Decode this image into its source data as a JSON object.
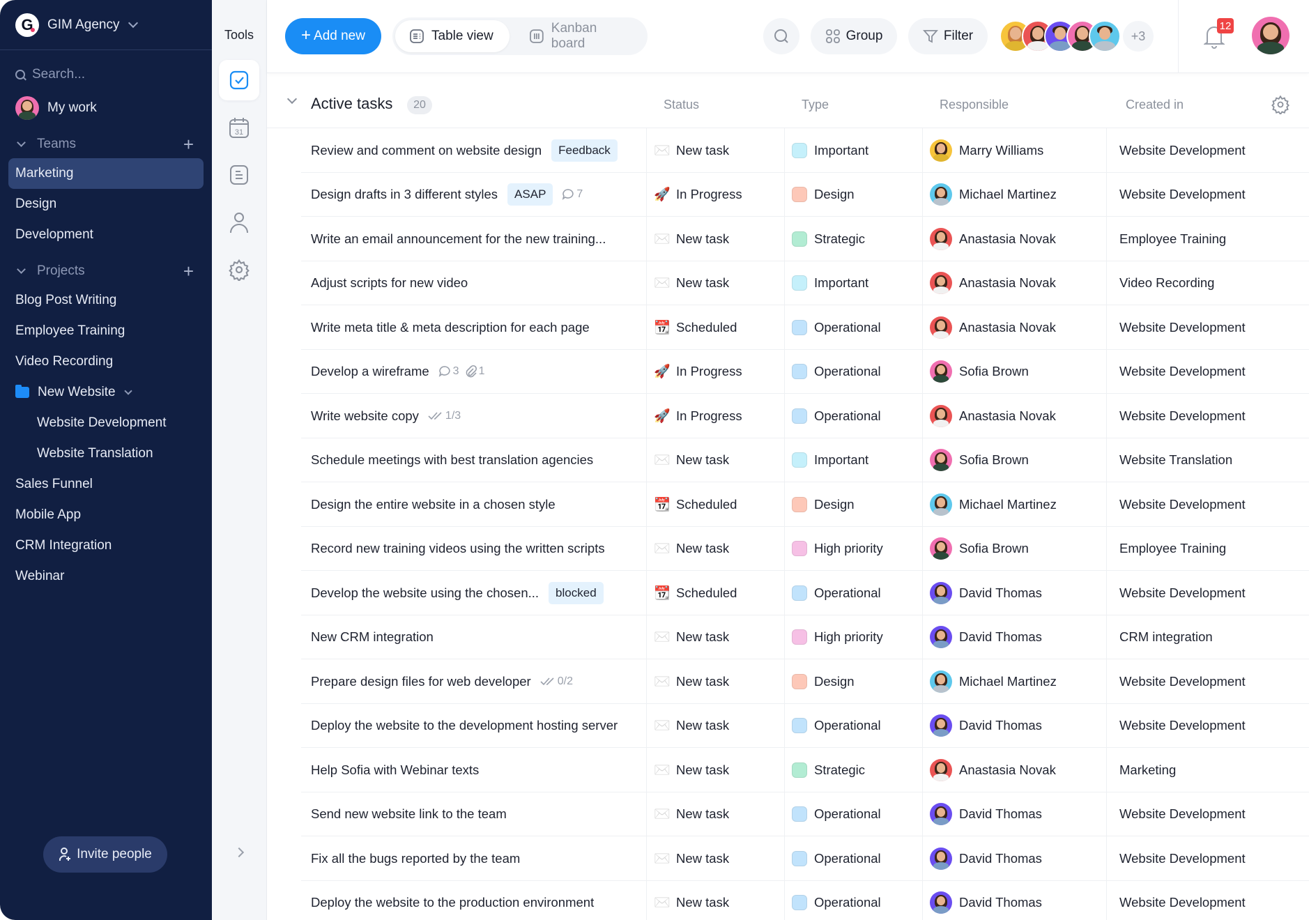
{
  "workspace": {
    "name": "GIM Agency",
    "logo_letter": "G"
  },
  "sidebar": {
    "search_placeholder": "Search...",
    "my_work": "My work",
    "teams_label": "Teams",
    "teams": [
      {
        "label": "Marketing",
        "active": true
      },
      {
        "label": "Design"
      },
      {
        "label": "Development"
      }
    ],
    "projects_label": "Projects",
    "projects": [
      {
        "label": "Blog Post Writing"
      },
      {
        "label": "Employee Training"
      },
      {
        "label": "Video Recording"
      }
    ],
    "folder": {
      "label": "New Website",
      "children": [
        {
          "label": "Website Development"
        },
        {
          "label": "Website Translation"
        }
      ]
    },
    "projects_more": [
      {
        "label": "Sales Funnel"
      },
      {
        "label": "Mobile App"
      },
      {
        "label": "CRM Integration"
      },
      {
        "label": "Webinar"
      }
    ],
    "invite_label": "Invite people"
  },
  "tools": {
    "title": "Tools",
    "items": [
      "tasks-icon",
      "calendar-icon",
      "notes-icon",
      "people-icon",
      "settings-icon"
    ],
    "calendar_day": "31"
  },
  "toolbar": {
    "add_new": "Add new",
    "table_view": "Table view",
    "kanban_board": "Kanban board",
    "group": "Group",
    "filter": "Filter",
    "more_members": "+3",
    "notifications_count": "12"
  },
  "colors": {
    "accent": "#1a8df5",
    "sidebar_bg": "#111f42",
    "badge_red": "#ef4444",
    "type": {
      "Important": "#c5f0fb",
      "Design": "#fdc8b8",
      "Strategic": "#b2ecd3",
      "Operational": "#c1e3fc",
      "High priority": "#f6c0e5"
    },
    "people": {
      "Marry Williams": "#f7c43c",
      "Michael Martinez": "#5ec8ec",
      "Anastasia Novak": "#ea5454",
      "Sofia Brown": "#f06fb0",
      "David Thomas": "#6a4df0"
    }
  },
  "table": {
    "group_title": "Active tasks",
    "group_count": "20",
    "columns": {
      "status": "Status",
      "type": "Type",
      "responsible": "Responsible",
      "created_in": "Created in"
    },
    "rows": [
      {
        "task": "Review and comment on website design",
        "tag": "Feedback",
        "status": "New task",
        "status_icon": "envelope",
        "type": "Important",
        "responsible": "Marry Williams",
        "created_in": "Website Development"
      },
      {
        "task": "Design drafts in 3 different styles",
        "tag": "ASAP",
        "comments": "7",
        "status": "In Progress",
        "status_icon": "rocket",
        "type": "Design",
        "responsible": "Michael Martinez",
        "created_in": "Website Development"
      },
      {
        "task": "Write an email announcement for the new training...",
        "status": "New task",
        "status_icon": "envelope",
        "type": "Strategic",
        "responsible": "Anastasia Novak",
        "created_in": "Employee Training"
      },
      {
        "task": "Adjust scripts for new video",
        "status": "New task",
        "status_icon": "envelope",
        "type": "Important",
        "responsible": "Anastasia Novak",
        "created_in": "Video Recording"
      },
      {
        "task": "Write meta title & meta description for each page",
        "status": "Scheduled",
        "status_icon": "calendar",
        "type": "Operational",
        "responsible": "Anastasia Novak",
        "created_in": "Website Development"
      },
      {
        "task": "Develop a wireframe",
        "comments": "3",
        "attachments": "1",
        "status": "In Progress",
        "status_icon": "rocket",
        "type": "Operational",
        "responsible": "Sofia Brown",
        "created_in": "Website Development"
      },
      {
        "task": "Write website copy",
        "subtasks": "1/3",
        "status": "In Progress",
        "status_icon": "rocket",
        "type": "Operational",
        "responsible": "Anastasia Novak",
        "created_in": "Website Development"
      },
      {
        "task": "Schedule meetings with best translation agencies",
        "status": "New task",
        "status_icon": "envelope",
        "type": "Important",
        "responsible": "Sofia Brown",
        "created_in": "Website Translation"
      },
      {
        "task": "Design the entire website in a chosen style",
        "status": "Scheduled",
        "status_icon": "calendar",
        "type": "Design",
        "responsible": "Michael Martinez",
        "created_in": "Website Development"
      },
      {
        "task": "Record new training videos using the written scripts",
        "status": "New task",
        "status_icon": "envelope",
        "type": "High priority",
        "responsible": "Sofia Brown",
        "created_in": "Employee Training"
      },
      {
        "task": "Develop the website using the chosen...",
        "tag": "blocked",
        "status": "Scheduled",
        "status_icon": "calendar",
        "type": "Operational",
        "responsible": "David Thomas",
        "created_in": "Website Development"
      },
      {
        "task": "New CRM integration",
        "status": "New task",
        "status_icon": "envelope",
        "type": "High priority",
        "responsible": "David Thomas",
        "created_in": "CRM integration"
      },
      {
        "task": "Prepare design files for web developer",
        "subtasks": "0/2",
        "status": "New task",
        "status_icon": "envelope",
        "type": "Design",
        "responsible": "Michael Martinez",
        "created_in": "Website Development"
      },
      {
        "task": "Deploy the website to the development hosting server",
        "status": "New task",
        "status_icon": "envelope",
        "type": "Operational",
        "responsible": "David Thomas",
        "created_in": "Website Development"
      },
      {
        "task": "Help Sofia with Webinar texts",
        "status": "New task",
        "status_icon": "envelope",
        "type": "Strategic",
        "responsible": "Anastasia Novak",
        "created_in": "Marketing"
      },
      {
        "task": "Send new website link to the team",
        "status": "New task",
        "status_icon": "envelope",
        "type": "Operational",
        "responsible": "David Thomas",
        "created_in": "Website Development"
      },
      {
        "task": "Fix all the bugs reported by the team",
        "status": "New task",
        "status_icon": "envelope",
        "type": "Operational",
        "responsible": "David Thomas",
        "created_in": "Website Development"
      },
      {
        "task": "Deploy the website to the production environment",
        "status": "New task",
        "status_icon": "envelope",
        "type": "Operational",
        "responsible": "David Thomas",
        "created_in": "Website Development"
      }
    ]
  }
}
